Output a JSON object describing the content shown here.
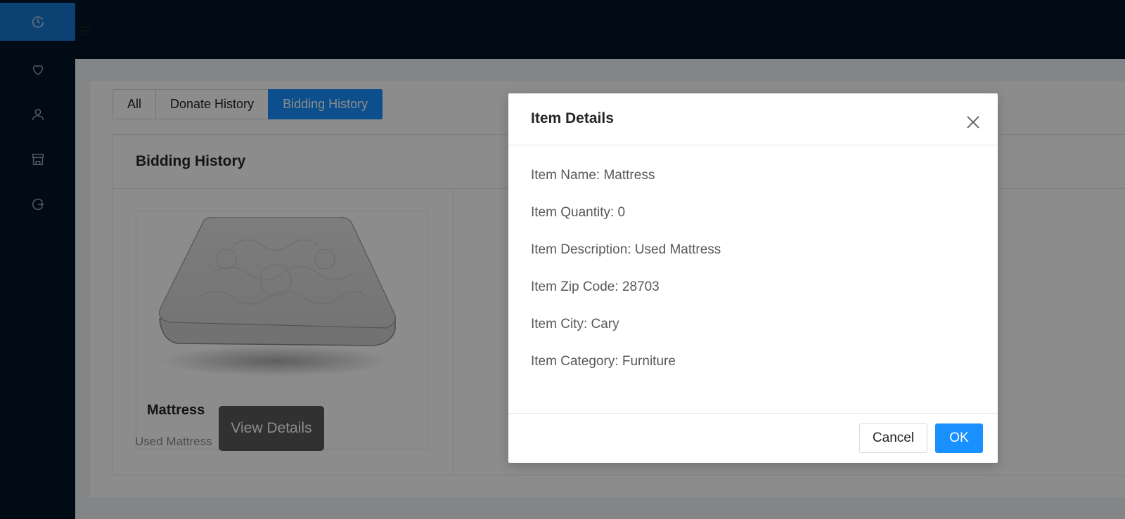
{
  "sidebar": {
    "items": [
      {
        "icon": "history-icon",
        "active": true
      },
      {
        "icon": "heart-icon",
        "active": false
      },
      {
        "icon": "user-icon",
        "active": false
      },
      {
        "icon": "shop-icon",
        "active": false
      },
      {
        "icon": "logout-icon",
        "active": false
      }
    ]
  },
  "colors": {
    "sidebar_bg": "#001529",
    "active_nav": "#1677d2",
    "primary": "#1890ff"
  },
  "tabs": [
    {
      "label": "All",
      "active": false
    },
    {
      "label": "Donate History",
      "active": false
    },
    {
      "label": "Bidding History",
      "active": true
    }
  ],
  "card_box": {
    "title": "Bidding History"
  },
  "item_card": {
    "title": "Mattress",
    "description": "Used Mattress"
  },
  "tooltip": {
    "text": "View Details"
  },
  "modal": {
    "title": "Item Details",
    "details": [
      "Item Name: Mattress",
      "Item Quantity: 0",
      "Item Description: Used Mattress",
      "Item Zip Code: 28703",
      "Item City: Cary",
      "Item Category: Furniture"
    ],
    "cancel_label": "Cancel",
    "ok_label": "OK"
  }
}
